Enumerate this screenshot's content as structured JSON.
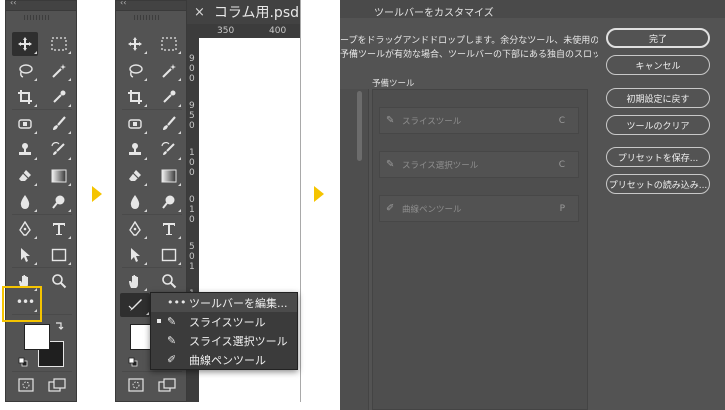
{
  "panel1": {
    "edit_toolbar_glyph": "•••",
    "edit_toolbar_icon": "ellipsis-icon",
    "collapse_glyph": "‹‹"
  },
  "panel2": {
    "collapse_glyph": "‹‹",
    "doc_tab": {
      "close_glyph": "×",
      "title": "コラム用.psd @"
    },
    "ruler_top": [
      "350",
      "400"
    ],
    "ruler_left": [
      "9",
      "0",
      "0",
      "9",
      "5",
      "0",
      "1",
      "0",
      "0",
      "0",
      "1",
      "0",
      "5",
      "0",
      "1",
      "1",
      "0",
      "0",
      "1",
      "1",
      "5"
    ],
    "context_menu": {
      "items": [
        {
          "glyph": "•••",
          "label": "ツールバーを編集...",
          "icon": "ellipsis-icon",
          "selected": true,
          "bullet": false
        },
        {
          "glyph": "✎",
          "label": "スライスツール",
          "icon": "slice-tool-icon",
          "selected": false,
          "bullet": true
        },
        {
          "glyph": "✎",
          "label": "スライス選択ツール",
          "icon": "slice-select-tool-icon",
          "selected": false,
          "bullet": false
        },
        {
          "glyph": "✐",
          "label": "曲線ペンツール",
          "icon": "curvature-pen-tool-icon",
          "selected": false,
          "bullet": false
        }
      ]
    }
  },
  "dialog": {
    "title": "ツールバーをカスタマイズ",
    "description_line1": "ープをドラッグアンドドロップします。余分なツール、未使用のツー",
    "description_line2": "予備ツールが有効な場合、ツールバーの下部にある独自のスロットに",
    "extra_tools_label": "予備ツール",
    "extra_tools": [
      {
        "glyph": "✎",
        "label": "スライスツール",
        "shortcut": "C",
        "icon": "slice-tool-icon"
      },
      {
        "glyph": "✎",
        "label": "スライス選択ツール",
        "shortcut": "C",
        "icon": "slice-select-tool-icon"
      },
      {
        "glyph": "✐",
        "label": "曲線ペンツール",
        "shortcut": "P",
        "icon": "curvature-pen-tool-icon"
      }
    ],
    "buttons": {
      "done": "完了",
      "cancel": "キャンセル",
      "restore_defaults": "初期設定に戻す",
      "clear_tools": "ツールのクリア",
      "save_preset": "プリセットを保存...",
      "load_preset": "プリセットの読み込み..."
    }
  },
  "colors": {
    "highlight": "#f5c400",
    "panel_bg": "#535353",
    "dark_bg": "#3b3b3b"
  }
}
